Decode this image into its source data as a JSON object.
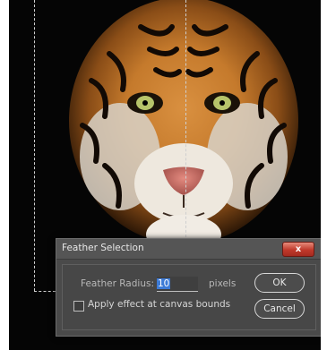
{
  "dialog": {
    "title": "Feather Selection",
    "close_label": "x",
    "feather_radius_label": "Feather Radius:",
    "feather_radius_value": "10",
    "feather_radius_unit": "pixels",
    "canvas_bounds_label": "Apply effect at canvas bounds",
    "canvas_bounds_checked": false,
    "ok_label": "OK",
    "cancel_label": "Cancel"
  }
}
